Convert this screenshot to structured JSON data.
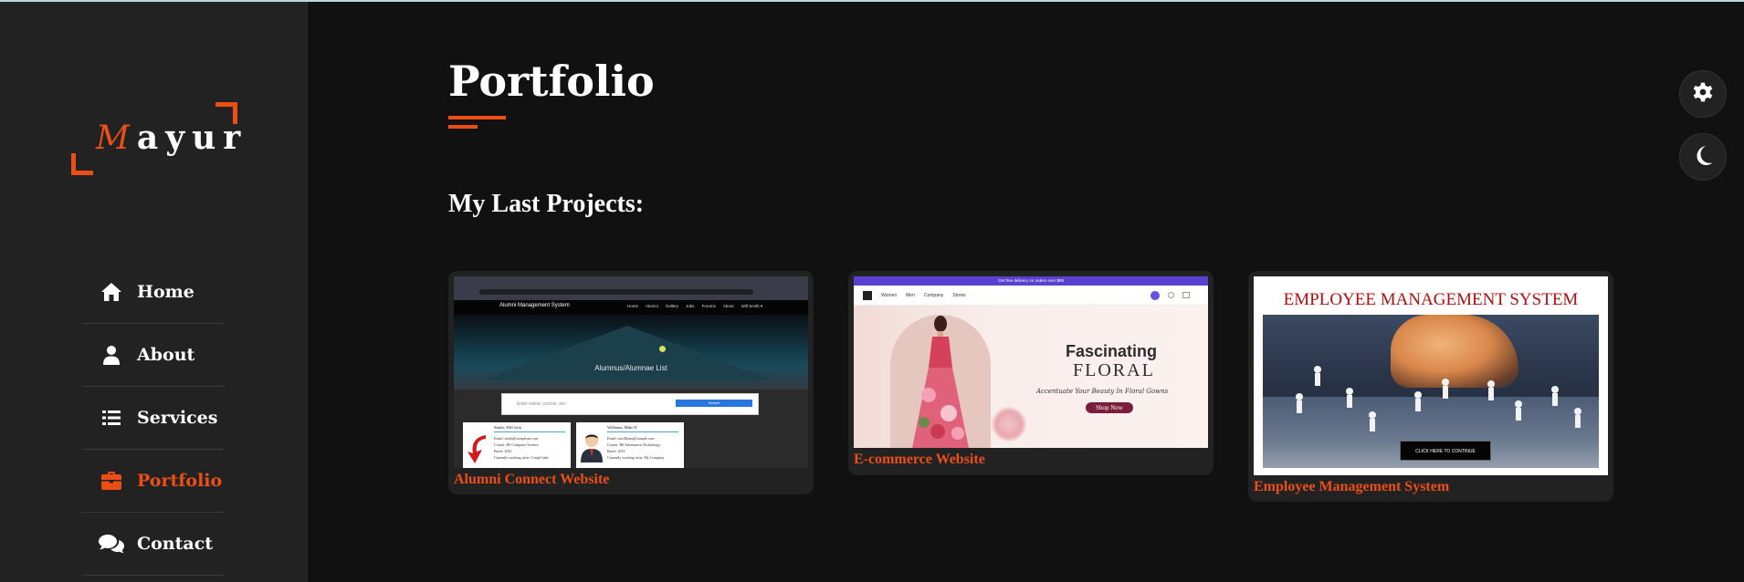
{
  "logo": {
    "first_letter": "M",
    "rest": "ayur"
  },
  "nav": [
    {
      "label": "Home",
      "icon": "home-icon",
      "active": false
    },
    {
      "label": "About",
      "icon": "user-icon",
      "active": false
    },
    {
      "label": "Services",
      "icon": "list-icon",
      "active": false
    },
    {
      "label": "Portfolio",
      "icon": "briefcase-icon",
      "active": true
    },
    {
      "label": "Contact",
      "icon": "comments-icon",
      "active": false
    }
  ],
  "page": {
    "title": "Portfolio",
    "subtitle": "My Last Projects:"
  },
  "projects": [
    {
      "caption": "Alumni Connect Website",
      "thumb": {
        "site_title": "Alumni Management System",
        "menu": [
          "Home",
          "Alumni",
          "Gallery",
          "Jobs",
          "Forums",
          "About",
          "Will Smith ▾"
        ],
        "banner_text": "Alumnus/Alumnae List",
        "search_placeholder": "Enter name, course, etc.",
        "search_button": "Search",
        "cards": [
          {
            "name": "Smith, Will Jack",
            "lines": [
              "Email: smith@sampleuts.com",
              "Course: BS Computer Science",
              "Batch: 2020",
              "Currently working in/as: CompCoder"
            ]
          },
          {
            "name": "Williams, Mike D",
            "lines": [
              "Email: mwilliams@sample.com",
              "Course: BS Information Technology",
              "Batch: 2019",
              "Currently working in/as: My Company"
            ]
          }
        ]
      }
    },
    {
      "caption": "E-commerce Website",
      "thumb": {
        "top_bar": "Get free delivery on orders over $99",
        "menu": [
          "Women",
          "Men",
          "Company",
          "Stores"
        ],
        "headline1": "Fascinating",
        "headline2": "FLORAL",
        "tagline": "Accentuate Your Beauty In Floral Gowns",
        "cta": "Shop Now"
      }
    },
    {
      "caption": "Employee Management System",
      "thumb": {
        "heading": "EMPLOYEE MANAGEMENT SYSTEM",
        "button": "CLICK HERE TO CONTINUE"
      }
    }
  ],
  "controls": {
    "settings_icon": "gear-icon",
    "theme_icon": "moon-icon"
  },
  "colors": {
    "accent": "#ec4f16",
    "sidebar_bg": "#222222",
    "main_bg": "#111111"
  }
}
